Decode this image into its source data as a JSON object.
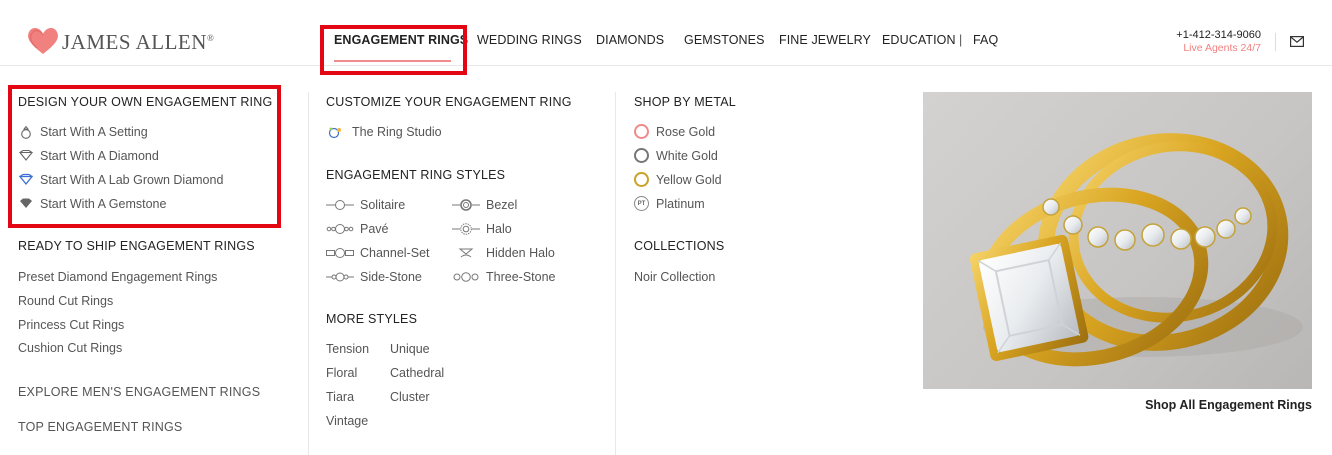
{
  "brand": {
    "name": "JAMES ALLEN",
    "reg": "®"
  },
  "nav": {
    "items": [
      "ENGAGEMENT RINGS",
      "WEDDING RINGS",
      "DIAMONDS",
      "GEMSTONES",
      "FINE JEWELRY",
      "EDUCATION",
      "FAQ"
    ],
    "separator": "|",
    "active_index": 0
  },
  "contact": {
    "phone": "+1-412-314-9060",
    "live": "Live Agents 24/7"
  },
  "design": {
    "title": "DESIGN YOUR OWN ENGAGEMENT RING",
    "items": [
      "Start With A Setting",
      "Start With A Diamond",
      "Start With A Lab Grown Diamond",
      "Start With A Gemstone"
    ],
    "icons": [
      "ring-setting-icon",
      "diamond-outline-icon",
      "lab-diamond-icon",
      "gemstone-icon"
    ]
  },
  "ready": {
    "title": "READY TO SHIP ENGAGEMENT RINGS",
    "items": [
      "Preset Diamond Engagement Rings",
      "Round Cut Rings",
      "Princess Cut Rings",
      "Cushion Cut Rings"
    ]
  },
  "mens": {
    "title": "EXPLORE MEN'S ENGAGEMENT RINGS"
  },
  "top": {
    "title": "TOP ENGAGEMENT RINGS"
  },
  "customize": {
    "title": "CUSTOMIZE YOUR ENGAGEMENT RING",
    "studio": "The Ring Studio"
  },
  "styles": {
    "title": "ENGAGEMENT RING STYLES",
    "left": [
      "Solitaire",
      "Pavé",
      "Channel-Set",
      "Side-Stone"
    ],
    "right": [
      "Bezel",
      "Halo",
      "Hidden Halo",
      "Three-Stone"
    ]
  },
  "more": {
    "title": "MORE STYLES",
    "left": [
      "Tension",
      "Floral",
      "Tiara",
      "Vintage"
    ],
    "right": [
      "Unique",
      "Cathedral",
      "Cluster"
    ]
  },
  "metal": {
    "title": "SHOP BY METAL",
    "items": [
      "Rose Gold",
      "White Gold",
      "Yellow Gold",
      "Platinum"
    ],
    "colors": [
      "#f08a8a",
      "#777777",
      "#c9a227",
      "#888888"
    ],
    "platinum_mark": "PT"
  },
  "collections": {
    "title": "COLLECTIONS",
    "items": [
      "Noir Collection"
    ]
  },
  "promo": {
    "cta": "Shop All Engagement Rings"
  },
  "colors": {
    "accent": "#f08080",
    "highlight": "#e30613",
    "gold": "#d9a521"
  }
}
